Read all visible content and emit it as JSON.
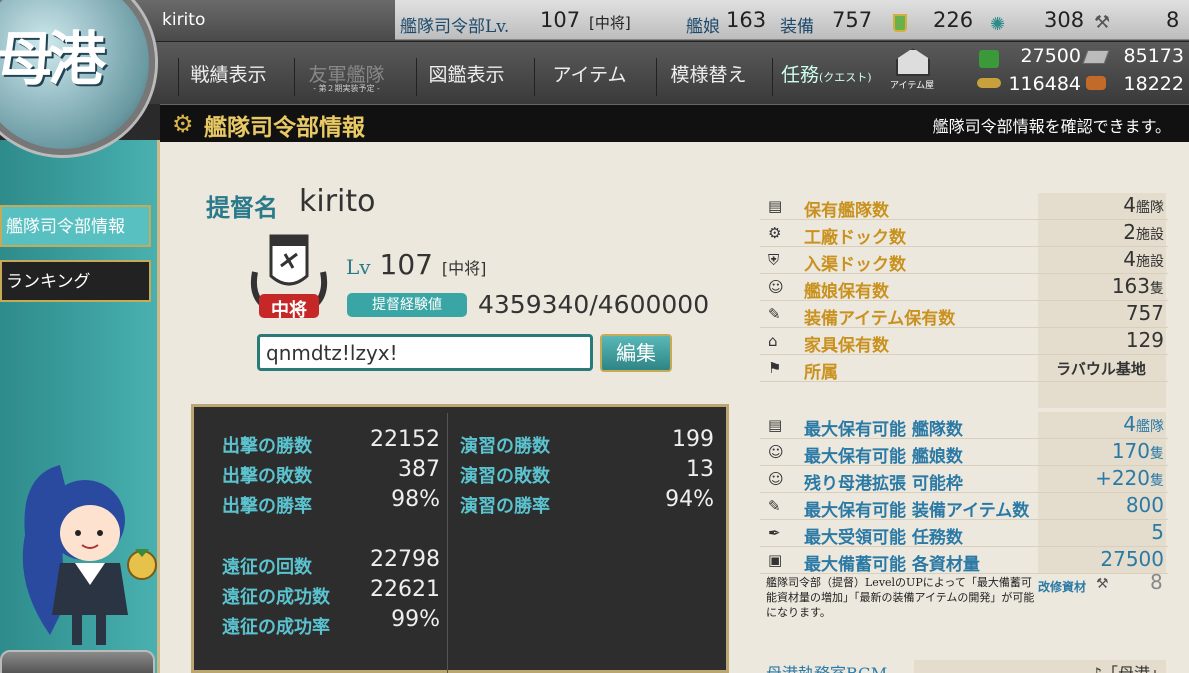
{
  "topbar": {
    "username": "kirito",
    "hq_label": "艦隊司令部Lv.",
    "hq_level": "107",
    "hq_rank": "[中将]",
    "ship_label": "艦娘",
    "ship_count": "163",
    "equip_label": "装備",
    "equip_count": "757",
    "bucket": "226",
    "devmat": "308",
    "screw": "8"
  },
  "emblem": {
    "text": "母港"
  },
  "menu": {
    "items": [
      {
        "label": "戦績表示",
        "sub": ""
      },
      {
        "label": "友軍艦隊",
        "sub": "- 第２期実装予定 -"
      },
      {
        "label": "図鑑表示",
        "sub": ""
      },
      {
        "label": "アイテム",
        "sub": ""
      },
      {
        "label": "模様替え",
        "sub": ""
      },
      {
        "label": "任務",
        "sub": "(クエスト)"
      }
    ],
    "shop_label": "アイテム屋"
  },
  "resources": {
    "fuel": "27500",
    "ammo": "116484",
    "steel": "85173",
    "bauxite": "18222"
  },
  "title": {
    "text": "艦隊司令部情報",
    "right": "艦隊司令部情報を確認できます。"
  },
  "sidebar": {
    "items": [
      {
        "label": "艦隊司令部情報"
      },
      {
        "label": "ランキング"
      }
    ]
  },
  "profile": {
    "admiral_label": "提督名",
    "admiral_name": "kirito",
    "lv_label": "Lv",
    "lv": "107",
    "rank": "[中将]",
    "rank_badge": "中将",
    "exp_label": "提督経験値",
    "exp": "4359340/4600000",
    "comment": "qnmdtz!lzyx!",
    "edit_label": "編集"
  },
  "stats": {
    "sortie": [
      {
        "label": "出撃の勝数",
        "value": "22152"
      },
      {
        "label": "出撃の敗数",
        "value": "387"
      },
      {
        "label": "出撃の勝率",
        "value": "98%"
      }
    ],
    "exercise": [
      {
        "label": "演習の勝数",
        "value": "199"
      },
      {
        "label": "演習の敗数",
        "value": "13"
      },
      {
        "label": "演習の勝率",
        "value": "94%"
      }
    ],
    "expedition": [
      {
        "label": "遠征の回数",
        "value": "22798"
      },
      {
        "label": "遠征の成功数",
        "value": "22621"
      },
      {
        "label": "遠征の成功率",
        "value": "99%"
      }
    ]
  },
  "info": {
    "rows": [
      {
        "icon": "fleet-icon",
        "glyph": "▤",
        "label": "保有艦隊数",
        "value": "4",
        "unit": "艦隊"
      },
      {
        "icon": "gear-icon",
        "glyph": "⚙",
        "label": "工廠ドック数",
        "value": "2",
        "unit": "施設"
      },
      {
        "icon": "repair-icon",
        "glyph": "⛨",
        "label": "入渠ドック数",
        "value": "4",
        "unit": "施設"
      },
      {
        "icon": "shipgirl-icon",
        "glyph": "☺",
        "label": "艦娘保有数",
        "value": "163",
        "unit": "隻"
      },
      {
        "icon": "equipment-icon",
        "glyph": "✎",
        "label": "装備アイテム保有数",
        "value": "757",
        "unit": ""
      },
      {
        "icon": "furniture-icon",
        "glyph": "⌂",
        "label": "家具保有数",
        "value": "129",
        "unit": ""
      },
      {
        "icon": "base-icon",
        "glyph": "⚑",
        "label": "所属",
        "value": "ラバウル基地",
        "unit": ""
      }
    ],
    "max_rows": [
      {
        "icon": "fleet-icon",
        "glyph": "▤",
        "label": "最大保有可能 艦隊数",
        "value": "4",
        "unit": "艦隊"
      },
      {
        "icon": "shipgirl-icon",
        "glyph": "☺",
        "label": "最大保有可能 艦娘数",
        "value": "170",
        "unit": "隻"
      },
      {
        "icon": "shipgirl-icon",
        "glyph": "☺",
        "label": "残り母港拡張 可能枠",
        "value": "+220",
        "unit": "隻"
      },
      {
        "icon": "equipment-icon",
        "glyph": "✎",
        "label": "最大保有可能 装備アイテム数",
        "value": "800",
        "unit": ""
      },
      {
        "icon": "quill-icon",
        "glyph": "✒",
        "label": "最大受領可能 任務数",
        "value": "5",
        "unit": ""
      },
      {
        "icon": "book-icon",
        "glyph": "▣",
        "label": "最大備蓄可能 各資材量",
        "value": "27500",
        "unit": ""
      }
    ],
    "note": "艦隊司令部（提督）LevelのUPによって「最大備蓄可能資材量の増加」「最新の装備アイテムの開発」が可能になります。",
    "kaishu_label": "改修資材",
    "kaishu_value": "8",
    "bgm_label": "母港執務室BGM",
    "bgm_value": "♪「母港」"
  },
  "colors": {
    "teal": "#3aa5a5",
    "gold": "#c9921f",
    "blue": "#2b7aa6"
  }
}
